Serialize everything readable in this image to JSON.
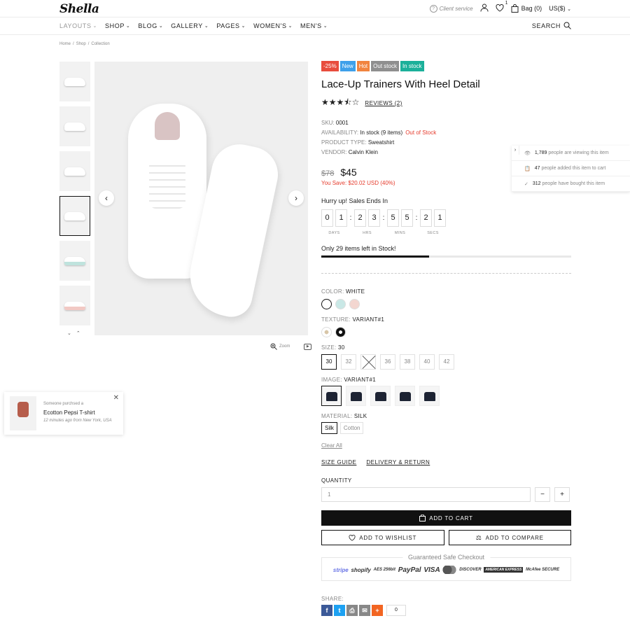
{
  "header": {
    "logo": "Shella",
    "client_service": "Client service",
    "wishlist_count": "1",
    "bag_label": "Bag (0)",
    "currency": "US($)"
  },
  "nav": {
    "items": [
      "LAYOUTS",
      "SHOP",
      "BLOG",
      "GALLERY",
      "PAGES",
      "WOMEN'S",
      "MEN'S"
    ],
    "search_label": "SEARCH"
  },
  "breadcrumb": [
    "Home",
    "/",
    "Shop",
    "/",
    "Collection"
  ],
  "gallery": {
    "zoom_label": "Zoom"
  },
  "product": {
    "badges": [
      {
        "label": "-25%",
        "color": "#e84c3d"
      },
      {
        "label": "New",
        "color": "#3ea0ea"
      },
      {
        "label": "Hot",
        "color": "#f1843f"
      },
      {
        "label": "Out stock",
        "color": "#8f8f8f"
      },
      {
        "label": "In stock",
        "color": "#1bb09a"
      }
    ],
    "title": "Lace-Up Trainers With Heel Detail",
    "stars": "★★★⯪☆",
    "reviews": "REVIEWS (2)",
    "sku_label": "SKU:",
    "sku": "0001",
    "availability_label": "AVAILABILITY:",
    "availability": "In stock (9 items)",
    "out_of_stock": "Out of Stock",
    "type_label": "PRODUCT TYPE:",
    "type": "Sweatshirt",
    "vendor_label": "VENDOR:",
    "vendor": "Calvin Klein",
    "old_price": "$78",
    "price": "$45",
    "you_save": "You Save: $20.02 USD (40%)",
    "hurry": "Hurry up! Sales Ends In",
    "timer": {
      "days": [
        "0",
        "1"
      ],
      "hrs": [
        "2",
        "3"
      ],
      "mins": [
        "5",
        "5"
      ],
      "secs": [
        "2",
        "1"
      ],
      "labels": [
        "DAYS",
        "HRS",
        "MINS",
        "SECS"
      ]
    },
    "stock_left": "Only 29 items left in Stock!",
    "stock_progress": 0.43
  },
  "options": {
    "color_label": "COLOR:",
    "color_value": "WHITE",
    "color_swatches": [
      "#ffffff",
      "#c9e8e6",
      "#f3d6d0"
    ],
    "texture_label": "TEXTURE:",
    "texture_value": "VARIANT#1",
    "size_label": "SIZE:",
    "size_value": "30",
    "sizes": [
      "30",
      "32",
      "34",
      "36",
      "38",
      "40",
      "42"
    ],
    "image_label": "IMAGE:",
    "image_value": "VARIANT#1",
    "material_label": "MATERIAL:",
    "material_value": "SILK",
    "materials": [
      "Silk",
      "Cotton"
    ],
    "clear_all": "Clear All",
    "size_guide": "SIZE GUIDE",
    "delivery_return": "DELIVERY & RETURN"
  },
  "purchase": {
    "quantity_label": "QUANTITY",
    "quantity_value": "1",
    "minus": "−",
    "plus": "+",
    "add_to_cart": "ADD TO CART",
    "add_to_wishlist": "ADD TO WISHLIST",
    "add_to_compare": "ADD TO COMPARE",
    "checkout_title": "Guaranteed Safe Checkout",
    "pay_logos": [
      "stripe",
      "shopify",
      "AES 256bit",
      "PayPal",
      "VISA",
      "mastercard",
      "DISCOVER",
      "AMERICAN EXPRESS",
      "McAfee SECURE"
    ]
  },
  "share": {
    "label": "SHARE:",
    "count": "0"
  },
  "viewers": {
    "row1_num": "1,789",
    "row1_text": "people are viewing this item",
    "row2_num": "47",
    "row2_text": "people added this item to cart",
    "row3_num": "312",
    "row3_text": "people have bought this item"
  },
  "popup": {
    "small": "Someone purchsed a",
    "name": "Ecotton Pepsi T-shirt",
    "time": "12 minutes ago from New York, USA"
  }
}
